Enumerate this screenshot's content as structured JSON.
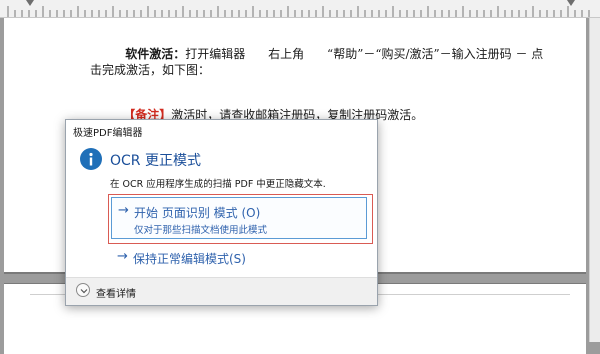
{
  "document": {
    "line1_bold": "软件激活：",
    "line1_rest": "打开编辑器      右上角      “帮助”－“购买/激活”－输入注册码 － 点",
    "line2": "击完成激活，如下图：",
    "line3_tag": "【备注】",
    "line3_rest": "激活时，请查收邮箱注册码，复制注册码激活。"
  },
  "dialog": {
    "window_title": "极速PDF编辑器",
    "icon": "info-icon",
    "heading": "OCR 更正模式",
    "description": "在 OCR 应用程序生成的扫描 PDF 中更正隐藏文本.",
    "option1_label": "开始 页面识别 模式 (O)",
    "option1_sub": "仅对于那些扫描文档使用此模式",
    "option2_label": "保持正常编辑模式(S)",
    "footer_label": "查看详情",
    "arrow_glyph": "→"
  },
  "colors": {
    "accent_blue": "#2f62ad",
    "highlight_red": "#d95b54",
    "note_red": "#d22b1f"
  }
}
